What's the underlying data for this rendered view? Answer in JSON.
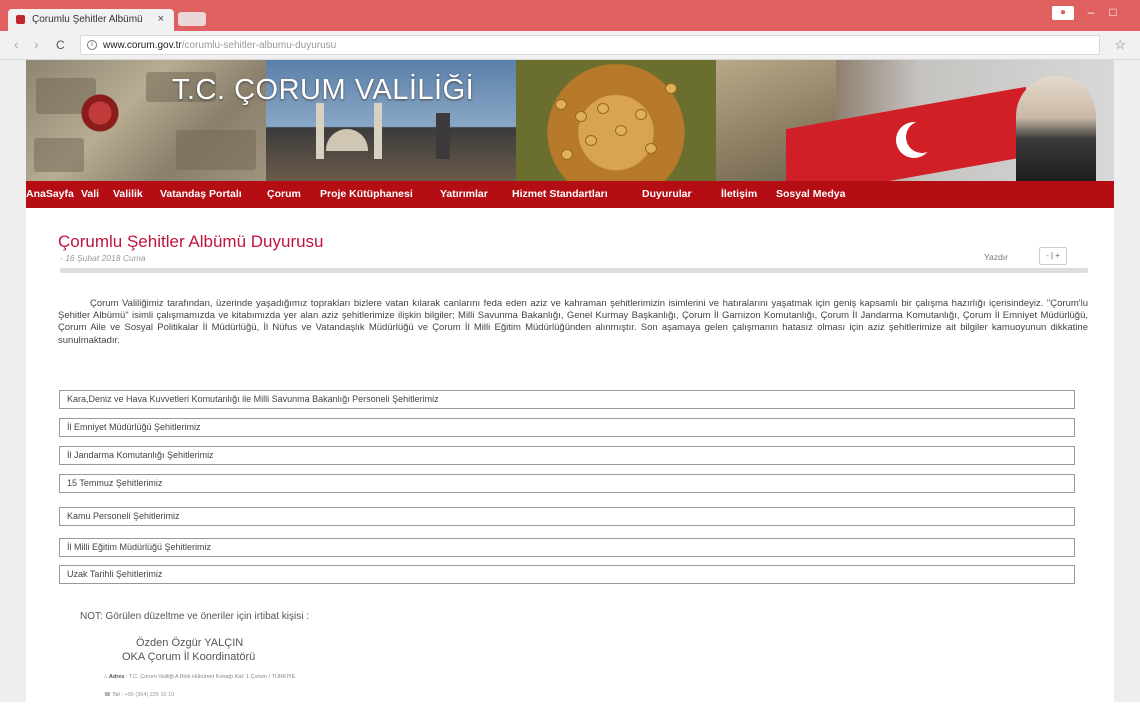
{
  "browser": {
    "tab_title": "Çorumlu Şehitler Albümü",
    "tab_close": "×",
    "nav_back": "‹",
    "nav_forward": "›",
    "reload": "C",
    "url_domain": "www.corum.gov.tr",
    "url_path": "/corumlu-sehitler-albumu-duyurusu",
    "window_controls": {
      "user": "●",
      "minimize": "–",
      "maximize": "□"
    },
    "star": "☆"
  },
  "site": {
    "banner_title": "T.C. ÇORUM VALİLİĞİ",
    "nav_items": [
      "AnaSayfa",
      "Vali",
      "Valilik",
      "Vatandaş Portalı",
      "Çorum",
      "Proje Kütüphanesi",
      "Yatırımlar",
      "Hizmet Standartları",
      "Duyurular",
      "İletişim",
      "Sosyal Medya"
    ]
  },
  "article": {
    "title": "Çorumlu Şehitler Albümü Duyurusu",
    "date": "- 16 Şubat 2018 Cuma",
    "print_label": "Yazdır",
    "text_size_controls": "- | +",
    "intro": "Çorum Valiliğimiz tarafından, üzerinde yaşadığımız toprakları bizlere vatan kılarak canlarını feda eden aziz ve kahraman şehitlerimizin isimlerini ve hatıralarını yaşatmak için geniş kapsamlı bir çalışma hazırlığı içerisindeyiz. \"Çorum'lu Şehitler Albümü\" isimli çalışmamızda ve kitabımızda yer alan aziz şehitlerimize ilişkin bilgiler; Milli Savunma Bakanlığı, Genel Kurmay Başkanlığı, Çorum İl Garnizon Komutanlığı, Çorum İl Jandarma Komutanlığı, Çorum İl Emniyet Müdürlüğü, Çorum Aile ve Sosyal Politikalar İl Müdürlüğü, İl Nüfus ve Vatandaşlık Müdürlüğü ve Çorum İl Milli Eğitim Müdürlüğünden alınmıştır. Son aşamaya gelen çalışmanın hatasız olması için aziz şehitlerimize ait bilgiler kamuoyunun dikkatine sunulmaktadır.",
    "sections": [
      "Kara,Deniz ve Hava Kuvvetleri Komutanlığı ile Milli Savunma Bakanlığı Personeli Şehitlerimiz",
      "İl Emniyet Müdürlüğü Şehitlerimiz",
      "İl Jandarma Komutanlığı Şehitlerimiz",
      "15 Temmuz Şehitlerimiz",
      "Kamu Personeli Şehitlerimiz",
      "İl Milli Eğitim Müdürlüğü Şehitlerimiz",
      "Uzak Tarihli Şehitlerimiz"
    ],
    "note": "NOT: Görülen düzeltme ve öneriler için irtibat kişisi :",
    "contact_name": "Özden Özgür YALÇIN",
    "contact_org": "OKA Çorum İl Koordinatörü"
  },
  "footer": {
    "address_label": "Adres",
    "address": ": T.C. Çorum Valiliği A Blok Hükümet Konağı Kat: 1 Çorum / TÜRKİYE",
    "phone_label": "Tel",
    "phone": ": +90 (364) 225 10 10"
  }
}
